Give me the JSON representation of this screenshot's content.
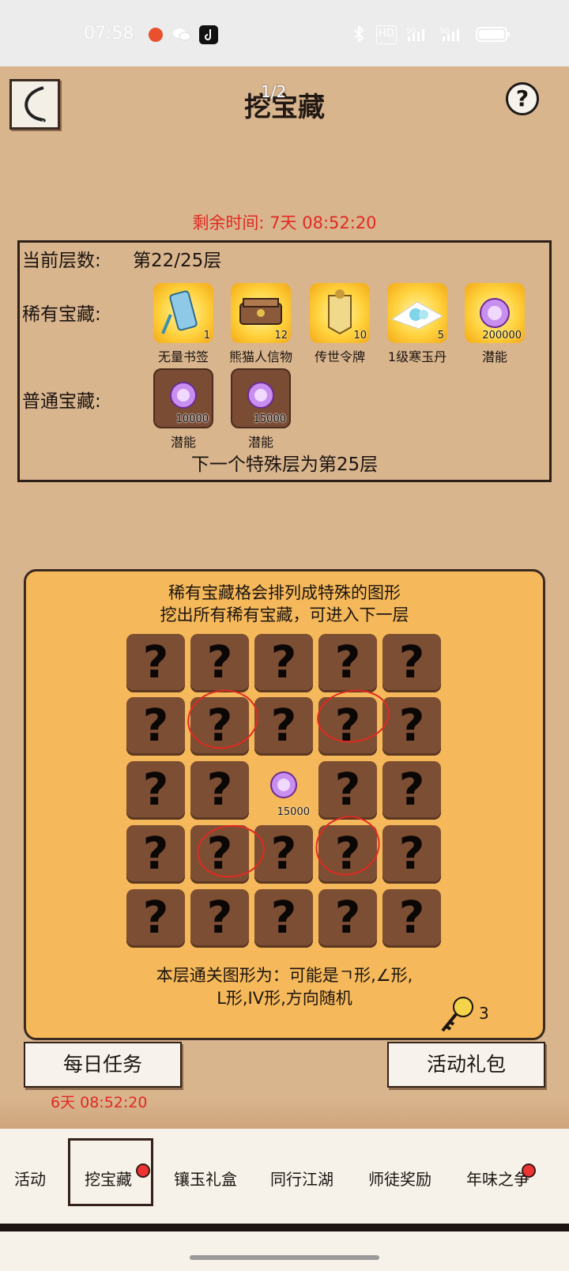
{
  "status_bar": {
    "time": "07:58",
    "network": "5G",
    "hd": "HD"
  },
  "header": {
    "title": "挖宝藏",
    "page_indicator": "1/2",
    "help_label": "?"
  },
  "remaining_time": "剩余时间: 7天 08:52:20",
  "info": {
    "current_layer_label": "当前层数:",
    "current_layer_value": "第22/25层",
    "rare_label": "稀有宝藏:",
    "rare_items": [
      {
        "name": "无量书签",
        "count": "1"
      },
      {
        "name": "熊猫人信物",
        "count": "12"
      },
      {
        "name": "传世令牌",
        "count": "10"
      },
      {
        "name": "1级寒玉丹",
        "count": "5"
      },
      {
        "name": "潜能",
        "count": "200000"
      }
    ],
    "common_label": "普通宝藏:",
    "common_items": [
      {
        "name": "潜能",
        "count": "10000"
      },
      {
        "name": "潜能",
        "count": "15000"
      }
    ],
    "next_special": "下一个特殊层为第25层"
  },
  "game": {
    "desc_line1": "稀有宝藏格会排列成特殊的图形",
    "desc_line2": "挖出所有稀有宝藏，可进入下一层",
    "hidden_symbol": "?",
    "revealed_count": "15000",
    "clear_line1": "本层通关图形为：可能是ㄱ形,∠形,",
    "clear_line2": "L形,IV形,方向随机",
    "key_count": "3"
  },
  "buttons": {
    "daily": "每日任务",
    "gift": "活动礼包"
  },
  "daily_timer": "6天 08:52:20",
  "tabs": [
    "活动",
    "挖宝藏",
    "镶玉礼盒",
    "同行江湖",
    "师徒奖励",
    "年味之争"
  ]
}
